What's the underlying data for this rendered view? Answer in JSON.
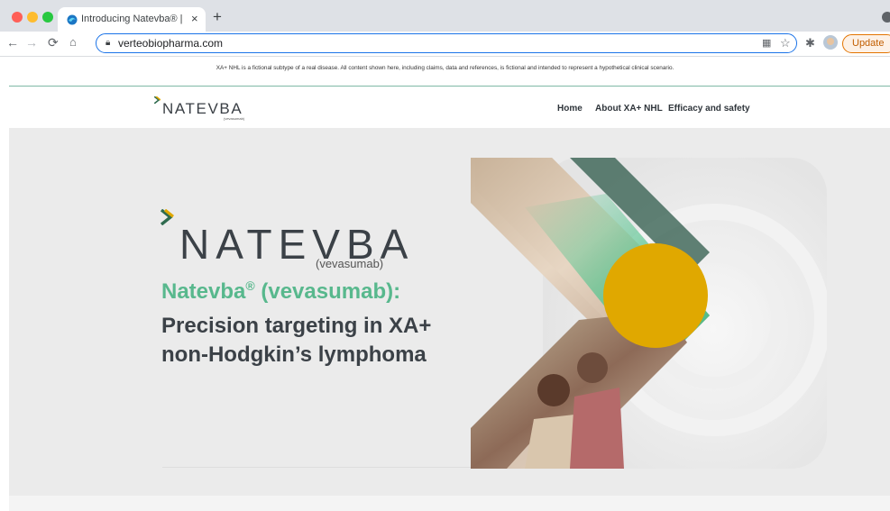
{
  "browser": {
    "tab_title": "Introducing Natevba® | wwwdev",
    "tab_close": "×",
    "new_tab": "+",
    "url": "verteobiopharma.com",
    "update_label": "Update"
  },
  "banner": {
    "disclaimer": "XA+ NHL is a fictional subtype of a real disease. All content shown here, including claims, data and references, is fictional and intended to represent a hypothetical clinical scenario."
  },
  "header": {
    "logo_text": "NATEVBA",
    "logo_subtext": "(vevasumab)",
    "nav": [
      {
        "label": "Home"
      },
      {
        "label": "About XA+ NHL"
      },
      {
        "label": "Efficacy and safety"
      }
    ]
  },
  "hero": {
    "logo_text": "NATEVBA",
    "logo_subtext": "(vevasumab)",
    "headline_brand": "Natevba",
    "headline_reg": "®",
    "headline_generic": " (vevasumab):",
    "headline_line2": "Precision targeting in XA+",
    "headline_line3": "non-Hodgkin’s lymphoma"
  },
  "colors": {
    "brand_green": "#58b88d",
    "brand_dark": "#3b4147",
    "accent_yellow": "#e0a800",
    "chrome_update": "#e37400"
  },
  "icons": {
    "back": "arrow-left-icon",
    "forward": "arrow-right-icon",
    "reload": "reload-icon",
    "home": "home-icon",
    "lock": "lock-icon",
    "qr": "qr-code-icon",
    "bookmark": "star-icon",
    "extensions": "puzzle-icon"
  }
}
